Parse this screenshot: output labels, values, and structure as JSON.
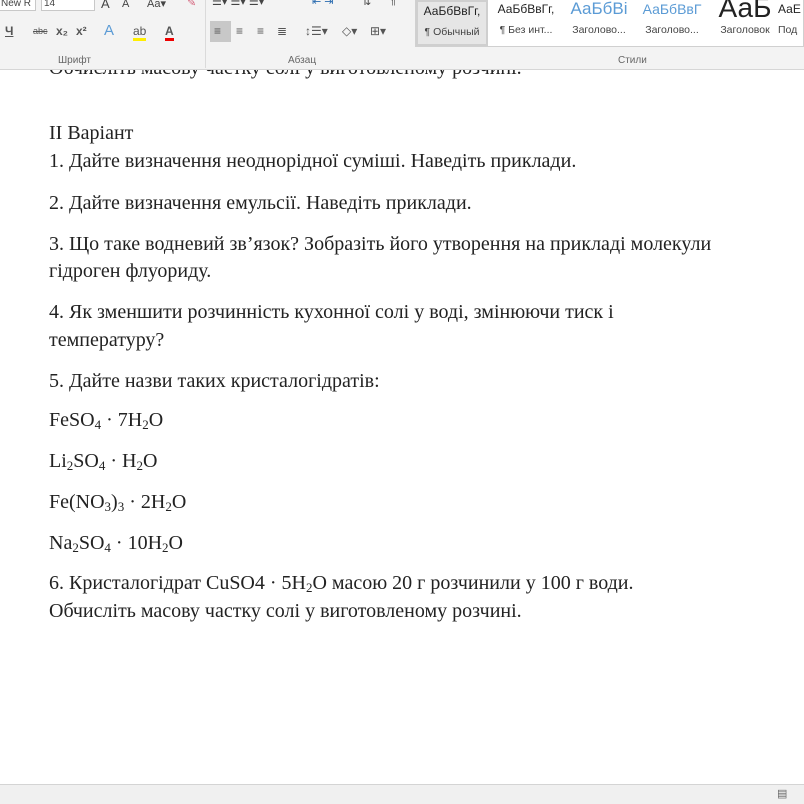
{
  "ribbon": {
    "font_name": "New R",
    "font_size": "14",
    "groups": {
      "font": "Шрифт",
      "paragraph": "Абзац",
      "styles": "Стили"
    },
    "styles": [
      {
        "preview": "АаБбВвГг,",
        "name": "¶ Обычный",
        "selected": true
      },
      {
        "preview": "АаБбВвГг,",
        "name": "¶ Без инт..."
      },
      {
        "preview": "АаБбВі",
        "name": "Заголово..."
      },
      {
        "preview": "АаБбВвГ",
        "name": "Заголово..."
      },
      {
        "preview": "АаБ",
        "name": "Заголовок"
      },
      {
        "preview": "АаЕ",
        "name": "Под"
      }
    ]
  },
  "document": {
    "clipped_line": "Обчисліть масову частку солі у виготовленому розчині.",
    "variant": "II Варіант",
    "q1": "1. Дайте визначення неоднорідної суміші. Наведіть приклади.",
    "q2": "2. Дайте визначення емульсії. Наведіть приклади.",
    "q3a": "3. Що таке водневий зв’язок? Зобразіть його утворення на прикладі молекули",
    "q3b": "гідроген флуориду.",
    "q4a": "4. Як зменшити розчинність кухонної солі у воді, змінюючи тиск і",
    "q4b": "температуру?",
    "q5": "5. Дайте назви таких кристалогідратів:",
    "f1": [
      "FeSO",
      "4",
      " · 7H",
      "2",
      "O"
    ],
    "f2": [
      "Li",
      "2",
      "SO",
      "4",
      " · H",
      "2",
      "O"
    ],
    "f3": [
      "Fe(NO",
      "3",
      ")",
      "3",
      " · 2H",
      "2",
      "O"
    ],
    "f4": [
      "Na",
      "2",
      "SO",
      "4",
      " · 10H",
      "2",
      "O"
    ],
    "q6a": [
      "6. Кристалогідрат CuSO4 · 5H",
      "2",
      "O масою 20 г розчинили у 100 г води."
    ],
    "q6b": "Обчисліть масову частку солі у виготовленому розчині."
  }
}
